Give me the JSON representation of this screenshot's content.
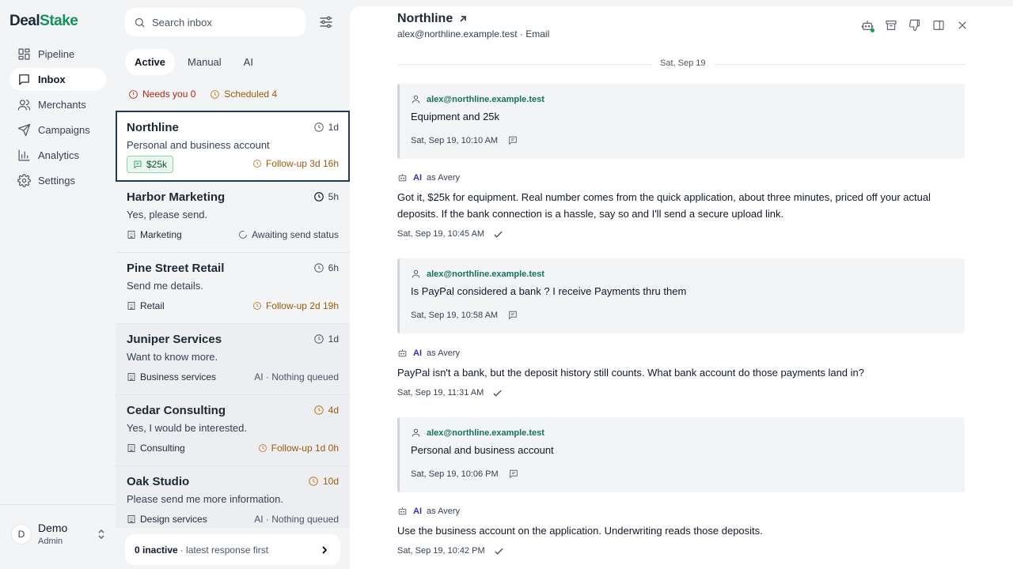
{
  "brand": {
    "part1": "Deal",
    "part2": "Stake"
  },
  "nav": [
    {
      "label": "Pipeline",
      "icon": "grid-icon"
    },
    {
      "label": "Inbox",
      "icon": "message-icon",
      "active": true
    },
    {
      "label": "Merchants",
      "icon": "users-icon"
    },
    {
      "label": "Campaigns",
      "icon": "send-icon"
    },
    {
      "label": "Analytics",
      "icon": "bar-chart-icon"
    },
    {
      "label": "Settings",
      "icon": "gear-icon"
    }
  ],
  "user": {
    "initial": "D",
    "name": "Demo",
    "role": "Admin"
  },
  "search": {
    "placeholder": "Search inbox"
  },
  "tabs": [
    "Active",
    "Manual",
    "AI"
  ],
  "counts": {
    "needs_you": "Needs you 0",
    "scheduled": "Scheduled 4"
  },
  "conversations": [
    {
      "name": "Northline",
      "age": "1d",
      "preview": "Personal and business account",
      "badge": "$25k",
      "status": "Follow-up 3d 16h"
    },
    {
      "name": "Harbor Marketing",
      "age": "5h",
      "preview": "Yes, please send.",
      "tag": "Marketing",
      "status": "Awaiting send status"
    },
    {
      "name": "Pine Street Retail",
      "age": "6h",
      "preview": "Send me details.",
      "tag": "Retail",
      "status": "Follow-up 2d 19h"
    },
    {
      "name": "Juniper Services",
      "age": "1d",
      "preview": "Want to know more.",
      "tag": "Business services",
      "status": "AI · Nothing queued"
    },
    {
      "name": "Cedar Consulting",
      "age": "4d",
      "preview": "Yes, I would be interested.",
      "tag": "Consulting",
      "status": "Follow-up 1d 0h"
    },
    {
      "name": "Oak Studio",
      "age": "10d",
      "preview": "Please send me more information.",
      "tag": "Design services",
      "status": "AI · Nothing queued"
    }
  ],
  "inactive": {
    "count": "0 inactive",
    "note": "· latest response first"
  },
  "thread": {
    "title": "Northline",
    "subtitle": "alex@northline.example.test · Email",
    "date_separator": "Sat, Sep 19",
    "messages": [
      {
        "from": "alex@northline.example.test",
        "body": "Equipment and 25k",
        "time": "Sat, Sep 19, 10:10 AM"
      },
      {
        "ai": "AI",
        "as": "as Avery",
        "body": "Got it, $25k for equipment. Real number comes from the quick application, about three minutes, priced off your actual deposits. If the bank connection is a hassle, say so and I'll send a secure upload link.",
        "time": "Sat, Sep 19, 10:45 AM"
      },
      {
        "from": "alex@northline.example.test",
        "body": "Is PayPal considered a bank ? I receive Payments thru them",
        "time": "Sat, Sep 19, 10:58 AM"
      },
      {
        "ai": "AI",
        "as": "as Avery",
        "body": "PayPal isn't a bank, but the deposit history still counts. What bank account do those payments land in?",
        "time": "Sat, Sep 19, 11:31 AM"
      },
      {
        "from": "alex@northline.example.test",
        "body": "Personal and business account",
        "time": "Sat, Sep 19, 10:06 PM"
      },
      {
        "ai": "AI",
        "as": "as Avery",
        "body": "Use the business account on the application. Underwriting reads those deposits.",
        "time": "Sat, Sep 19, 10:42 PM"
      }
    ]
  }
}
